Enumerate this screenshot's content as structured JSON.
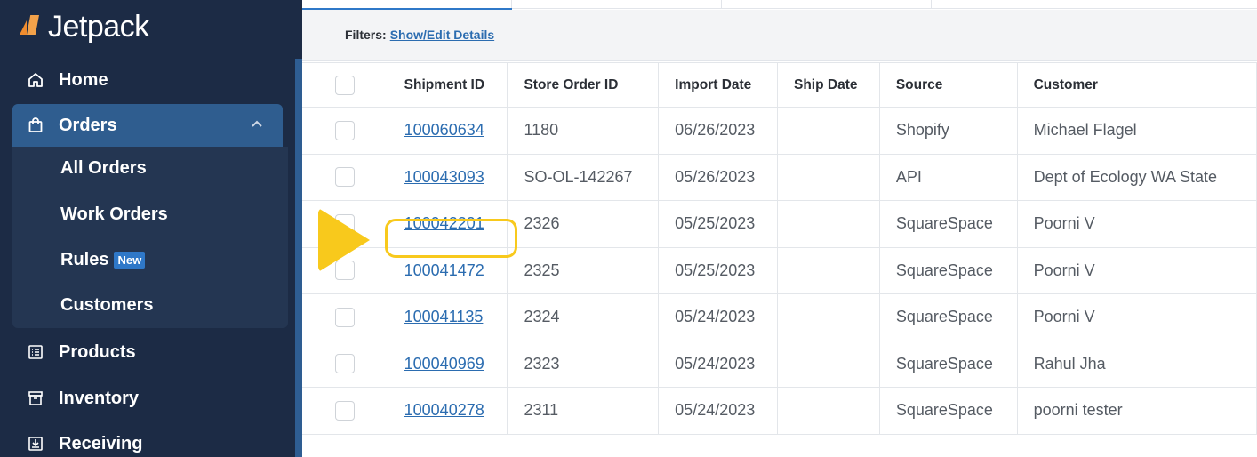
{
  "app": {
    "name": "Jetpack"
  },
  "sidebar": {
    "items": [
      {
        "label": "Home",
        "icon": "home-icon"
      },
      {
        "label": "Orders",
        "icon": "shopping-bag-icon",
        "active": true,
        "expanded": true
      },
      {
        "label": "Products",
        "icon": "list-icon"
      },
      {
        "label": "Inventory",
        "icon": "archive-box-icon"
      },
      {
        "label": "Receiving",
        "icon": "download-box-icon"
      }
    ],
    "orders_submenu": [
      {
        "label": "All Orders"
      },
      {
        "label": "Work Orders"
      },
      {
        "label": "Rules",
        "badge": "New"
      },
      {
        "label": "Customers"
      }
    ]
  },
  "filters": {
    "label": "Filters:",
    "link": "Show/Edit Details"
  },
  "table": {
    "columns": [
      "Shipment ID",
      "Store Order ID",
      "Import Date",
      "Ship Date",
      "Source",
      "Customer"
    ],
    "rows": [
      {
        "shipment_id": "100060634",
        "store_order_id": "1180",
        "import_date": "06/26/2023",
        "ship_date": "",
        "source": "Shopify",
        "customer": "Michael Flagel"
      },
      {
        "shipment_id": "100043093",
        "store_order_id": "SO-OL-142267",
        "import_date": "05/26/2023",
        "ship_date": "",
        "source": "API",
        "customer": "Dept of Ecology WA State"
      },
      {
        "shipment_id": "100042201",
        "store_order_id": "2326",
        "import_date": "05/25/2023",
        "ship_date": "",
        "source": "SquareSpace",
        "customer": "Poorni V"
      },
      {
        "shipment_id": "100041472",
        "store_order_id": "2325",
        "import_date": "05/25/2023",
        "ship_date": "",
        "source": "SquareSpace",
        "customer": "Poorni V"
      },
      {
        "shipment_id": "100041135",
        "store_order_id": "2324",
        "import_date": "05/24/2023",
        "ship_date": "",
        "source": "SquareSpace",
        "customer": "Poorni V"
      },
      {
        "shipment_id": "100040969",
        "store_order_id": "2323",
        "import_date": "05/24/2023",
        "ship_date": "",
        "source": "SquareSpace",
        "customer": "Rahul Jha"
      },
      {
        "shipment_id": "100040278",
        "store_order_id": "2311",
        "import_date": "05/24/2023",
        "ship_date": "",
        "source": "SquareSpace",
        "customer": "poorni tester"
      }
    ]
  },
  "colors": {
    "sidebar_bg": "#1c2b45",
    "active_nav": "#2f5d8f",
    "link": "#2b6cb0",
    "highlight": "#f8c91c",
    "logo_orange": "#f08c2e"
  }
}
